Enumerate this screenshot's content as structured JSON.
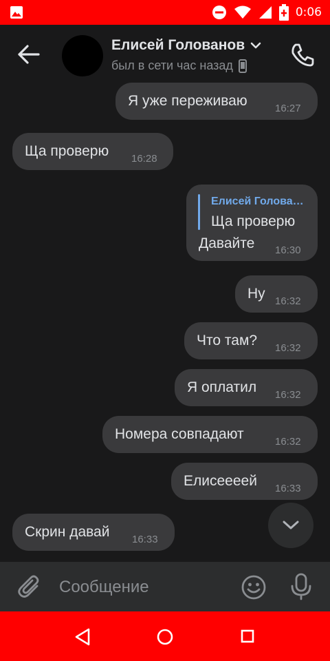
{
  "status_bar": {
    "time": "0:06"
  },
  "header": {
    "contact_name": "Елисей Голованов",
    "last_seen": "был в сети час назад"
  },
  "messages": [
    {
      "direction": "out",
      "text": "Я уже переживаю",
      "time": "16:27"
    },
    {
      "direction": "in",
      "text": "Ща проверю",
      "time": "16:28"
    },
    {
      "direction": "out",
      "reply_author": "Елисей Голова…",
      "reply_text": "Ща проверю",
      "text": "Давайте",
      "time": "16:30"
    },
    {
      "direction": "out",
      "text": "Ну",
      "time": "16:32"
    },
    {
      "direction": "out",
      "text": "Что там?",
      "time": "16:32"
    },
    {
      "direction": "out",
      "text": "Я оплатил",
      "time": "16:32"
    },
    {
      "direction": "out",
      "text": "Номера совпадают",
      "time": "16:32"
    },
    {
      "direction": "out",
      "text": "Елисеееей",
      "time": "16:33"
    },
    {
      "direction": "in",
      "text": "Скрин давай",
      "time": "16:33"
    }
  ],
  "composer": {
    "placeholder": "Сообщение"
  },
  "icons": {
    "back": "arrow-left-icon",
    "call": "phone-icon",
    "attach": "paperclip-icon",
    "emoji": "smiley-icon",
    "mic": "microphone-icon",
    "scroll_down": "chevron-down-icon",
    "mobile": "mobile-phone-icon"
  },
  "colors": {
    "status_bar": "#ff0000",
    "nav_bar": "#ff0000",
    "background": "#19191a",
    "bubble": "#3a3a3c",
    "accent": "#71aaeb"
  }
}
